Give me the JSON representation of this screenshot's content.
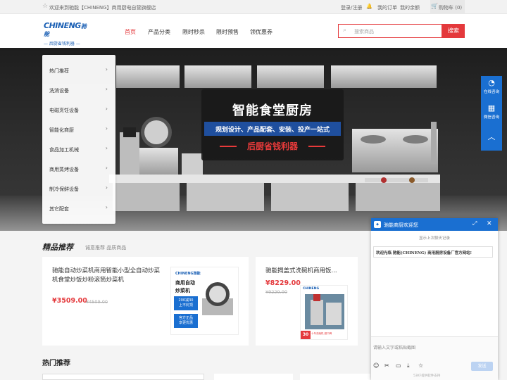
{
  "topbar": {
    "welcome": "欢迎来到驰能【CHINENG】商用厨电自营旗舰店",
    "login": "登录/注册",
    "orders": "我的订单",
    "balance": "我的余额",
    "cart": "购物车 (0)"
  },
  "logo": {
    "brand": "CHINENG",
    "brand_cn": "驰能",
    "slogan": "— 后厨省钱利器 —"
  },
  "nav": [
    "首页",
    "产品分类",
    "限时秒杀",
    "限时预售",
    "领优惠券"
  ],
  "search": {
    "placeholder": "搜索商品",
    "button": "搜索"
  },
  "menu": [
    "热门推荐",
    "洗消设备",
    "电磁烹饪设备",
    "智能化商厨",
    "食品加工机械",
    "商用蒸烤设备",
    "制冷保鲜设备",
    "其它配套"
  ],
  "banner": {
    "title": "智能食堂厨房",
    "subtitle": "规划设计、产品配套、安装、投产一站式",
    "slogan": "后厨省钱利器"
  },
  "featured": {
    "title": "精品推荐",
    "subtitle": "诚意推荐 品质商品"
  },
  "products": [
    {
      "name": "驰能自动炒菜机商用智能小型全自动炒菜机食堂炒饭炒粉滚筒炒菜机",
      "price": "¥3509.00",
      "old_price": "¥4509.00",
      "image": {
        "brand": "CHINENG驰能",
        "l1": "商用自动",
        "l2": "炒菜机",
        "promo1": "200减30",
        "promo2": "上不封顶",
        "promo3": "官方正品",
        "promo4": "享更优惠"
      }
    },
    {
      "name": "驰能揭盖式洗碗机商用饭...",
      "price": "¥8229.00",
      "old_price": "¥9229.00",
      "image": {
        "brand": "CHINENG",
        "badge": "30",
        "tag": "十年洗碗机 超口碑"
      }
    }
  ],
  "hot": {
    "title": "热门推荐"
  },
  "right_sidebar": {
    "consult": "在线咨询",
    "wechat": "微信咨询"
  },
  "chat": {
    "title": "驰能商厨欢迎您",
    "history": "显示上次聊天记录",
    "message": "欢迎光临 驰能(CHINENG) 商用厨房设备厂官方网站!",
    "input_placeholder": "请输入文字或粘贴截图",
    "send": "发送",
    "powered": "53KF提供软件支持"
  }
}
